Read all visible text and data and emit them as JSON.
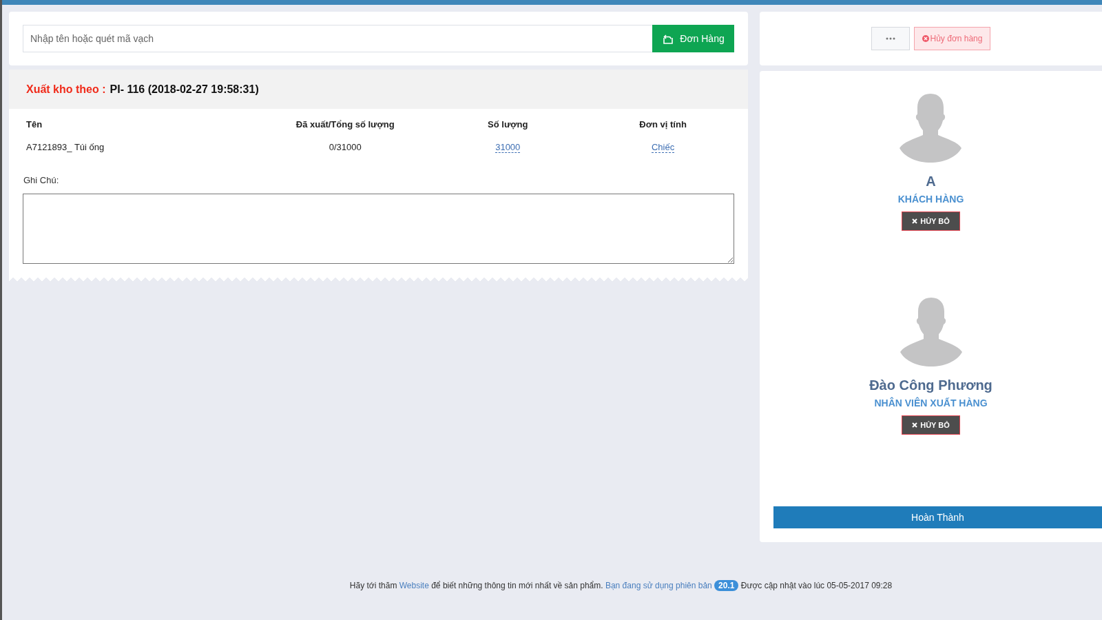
{
  "search": {
    "placeholder": "Nhập tên hoặc quét mã vạch"
  },
  "order_button": "Đơn Hàng",
  "cancel_order_button": "Hủy đơn hàng",
  "export": {
    "label": "Xuất kho theo :",
    "reference": "PI- 116 (2018-02-27 19:58:31)"
  },
  "table": {
    "columns": [
      "Tên",
      "Đã xuất/Tổng số lượng",
      "Số lượng",
      "Đơn vị tính"
    ],
    "rows": [
      {
        "name": "A7121893_ Túi ống",
        "exported": "0/31000",
        "quantity": "31000",
        "unit": "Chiếc"
      }
    ]
  },
  "note": {
    "label": "Ghi Chú:"
  },
  "people": [
    {
      "name": "A",
      "role": "KHÁCH HÀNG",
      "cancel": "HỦY BỎ"
    },
    {
      "name": "Đào Công Phương",
      "role": "NHÂN VIÊN XUẤT HÀNG",
      "cancel": "HỦY BỎ"
    }
  ],
  "complete_button": "Hoàn Thành",
  "footer": {
    "before": "Hãy tới thăm",
    "link": "Website",
    "middle": "để biết những thông tin mới nhất về sản phẩm.",
    "version_text": "Bạn đang sử dụng phiên bản",
    "version": "20.1",
    "after": "Được cập nhật vào lúc 05-05-2017 09:28"
  }
}
